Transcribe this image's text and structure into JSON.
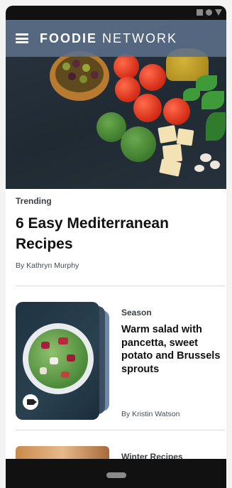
{
  "app": {
    "brand_bold": "FOODIE",
    "brand_light": "NETWORK"
  },
  "trending": {
    "label": "Trending",
    "headline": "6 Easy Mediterranean Recipes",
    "byline": "By Kathryn Murphy"
  },
  "cards": [
    {
      "category": "Season",
      "title": "Warm salad with pancetta, sweet potato and Brussels sprouts",
      "byline": "By Kristin Watson",
      "icon": "video-icon"
    },
    {
      "category": "Winter Recipes"
    }
  ],
  "icons": {
    "menu": "hamburger-menu-icon",
    "status": [
      "signal-square-icon",
      "battery-dot-icon",
      "wifi-triangle-icon"
    ],
    "home": "home-pill-icon"
  },
  "colors": {
    "app_bar": "#5C708A",
    "text_primary": "#111111",
    "text_secondary": "#444A50",
    "system_bar": "#111111"
  }
}
